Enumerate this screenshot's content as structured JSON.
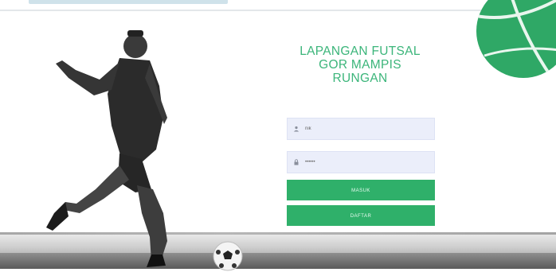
{
  "login": {
    "title_lines": [
      "LAPANGAN FUTSAL",
      "GOR MAMPIS",
      "RUNGAN"
    ],
    "username": {
      "placeholder": "nik",
      "icon": "user-icon"
    },
    "password": {
      "placeholder": "••••••",
      "icon": "lock-icon"
    },
    "masuk_label": "MASUK",
    "daftar_label": "DAFTAR"
  },
  "colors": {
    "accent": "#2fb06a",
    "title": "#3bb57a",
    "field_bg": "#ebeefa",
    "deco": "#2fa866"
  }
}
